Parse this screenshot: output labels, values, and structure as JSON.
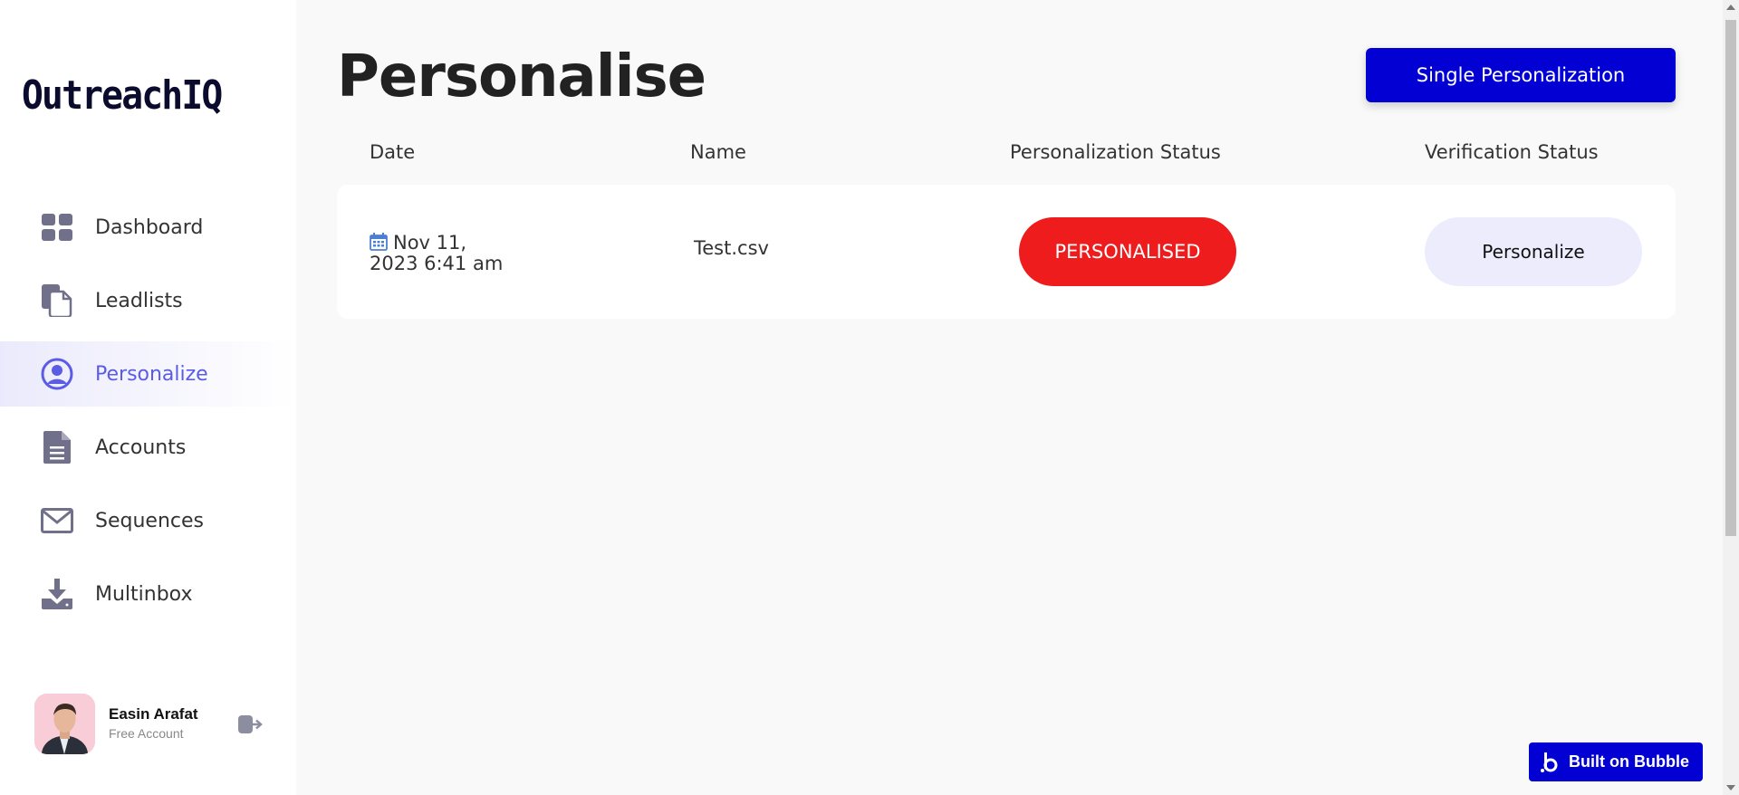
{
  "app": {
    "logo": "OutreachIQ",
    "accent_color": "#5b5ce6",
    "brand_blue": "#0300d4"
  },
  "sidebar": {
    "items": [
      {
        "label": "Dashboard",
        "icon": "dashboard-icon",
        "active": false
      },
      {
        "label": "Leadlists",
        "icon": "leadlists-icon",
        "active": false
      },
      {
        "label": "Personalize",
        "icon": "user-circle-icon",
        "active": true
      },
      {
        "label": "Accounts",
        "icon": "document-icon",
        "active": false
      },
      {
        "label": "Sequences",
        "icon": "envelope-icon",
        "active": false
      },
      {
        "label": "Multinbox",
        "icon": "download-tray-icon",
        "active": false
      }
    ],
    "user": {
      "name": "Easin Arafat",
      "plan": "Free Account"
    }
  },
  "main": {
    "title": "Personalise",
    "primary_button": "Single Personalization",
    "table": {
      "headers": [
        "Date",
        "Name",
        "Personalization Status",
        "Verification Status"
      ],
      "rows": [
        {
          "date_line1": "Nov 11,",
          "date_line2": "2023 6:41 am",
          "name": "Test.csv",
          "status": "PERSONALISED",
          "status_color": "#ee1c1c",
          "action": "Personalize"
        }
      ]
    }
  },
  "footer_badge": "Built on Bubble"
}
